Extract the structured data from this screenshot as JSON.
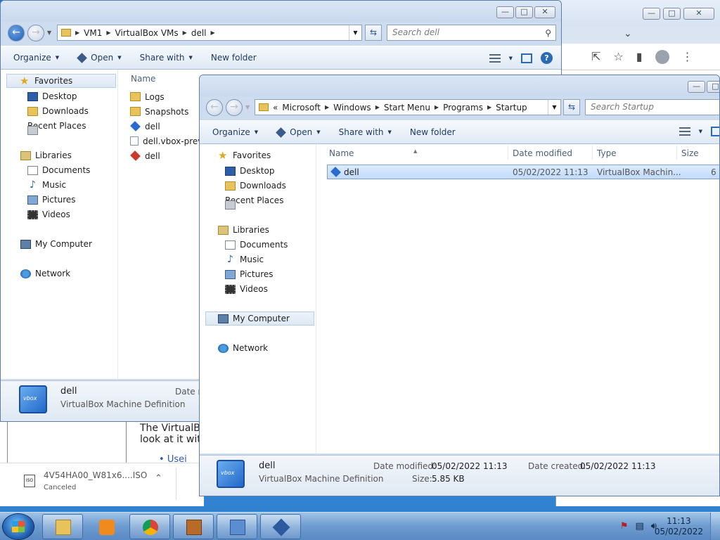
{
  "chrome": {
    "window_buttons": {
      "minimize": "—",
      "maximize": "□",
      "close": "✕"
    },
    "tab_chevron": "⌄",
    "toolbar_icons": [
      "share-icon",
      "star-icon",
      "side-panel-icon",
      "profile-icon",
      "menu-icon"
    ]
  },
  "webpage": {
    "text_line1": "The VirtualBo",
    "text_line2": "look at it wit",
    "link_text": "Usei"
  },
  "download": {
    "filename": "4V54HA00_W81x6....ISO",
    "status": "Canceled",
    "icon_label": "ISO",
    "caret": "⌃"
  },
  "win_back": {
    "breadcrumb": [
      "VM1",
      "VirtualBox VMs",
      "dell"
    ],
    "search_placeholder": "Search dell",
    "toolbar": {
      "organize": "Organize",
      "open": "Open",
      "share": "Share with",
      "newfolder": "New folder"
    },
    "nav": {
      "favorites": "Favorites",
      "desktop": "Desktop",
      "downloads": "Downloads",
      "recent": "Recent Places",
      "libraries": "Libraries",
      "documents": "Documents",
      "music": "Music",
      "pictures": "Pictures",
      "videos": "Videos",
      "computer": "My Computer",
      "network": "Network"
    },
    "col_name": "Name",
    "files": [
      "Logs",
      "Snapshots",
      "dell",
      "dell.vbox-prev",
      "dell"
    ],
    "details": {
      "name": "dell",
      "type": "VirtualBox Machine Definition",
      "date_label": "Date m"
    }
  },
  "win_front": {
    "breadcrumb": [
      "Microsoft",
      "Windows",
      "Start Menu",
      "Programs",
      "Startup"
    ],
    "breadcrumb_prefix": "«",
    "search_placeholder": "Search Startup",
    "toolbar": {
      "organize": "Organize",
      "open": "Open",
      "share": "Share with",
      "newfolder": "New folder"
    },
    "nav": {
      "favorites": "Favorites",
      "desktop": "Desktop",
      "downloads": "Downloads",
      "recent": "Recent Places",
      "libraries": "Libraries",
      "documents": "Documents",
      "music": "Music",
      "pictures": "Pictures",
      "videos": "Videos",
      "computer": "My Computer",
      "network": "Network"
    },
    "columns": {
      "name": "Name",
      "date": "Date modified",
      "type": "Type",
      "size": "Size"
    },
    "file": {
      "name": "dell",
      "date": "05/02/2022 11:13",
      "type": "VirtualBox Machin...",
      "size": "6 K"
    },
    "details": {
      "name": "dell",
      "type": "VirtualBox Machine Definition",
      "date_modified_label": "Date modified:",
      "date_modified": "05/02/2022 11:13",
      "date_created_label": "Date created:",
      "date_created": "05/02/2022 11:13",
      "size_label": "Size:",
      "size": "5.85 KB"
    }
  },
  "taskbar": {
    "apps": [
      "explorer-icon",
      "media-player-icon",
      "chrome-icon",
      "archive-icon",
      "control-panel-icon",
      "virtualbox-icon"
    ],
    "time": "11:13",
    "date": "05/02/2022"
  }
}
